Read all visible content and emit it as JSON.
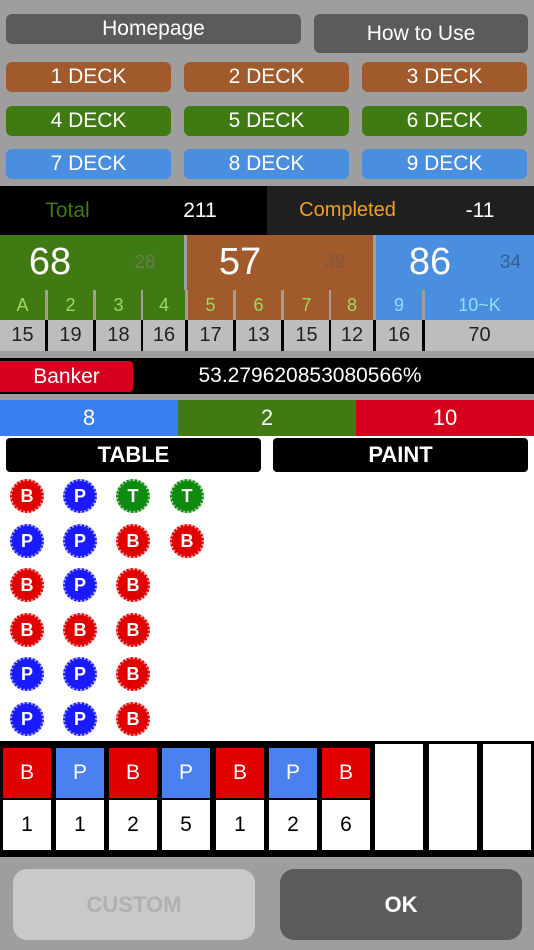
{
  "nav": {
    "homepage": "Homepage",
    "how_to_use": "How to Use"
  },
  "decks": [
    "1 DECK",
    "2 DECK",
    "3 DECK",
    "4 DECK",
    "5 DECK",
    "6 DECK",
    "7 DECK",
    "8 DECK",
    "9 DECK"
  ],
  "deck_colors": {
    "brown": "#a05a2c",
    "green": "#3f7a12",
    "blue": "#4a8ee0"
  },
  "stats": {
    "total_label": "Total",
    "total_value": "211",
    "completed_label": "Completed",
    "completed_value": "-11"
  },
  "boxes": [
    {
      "big": "68",
      "small": "28",
      "color": "#3f7a12",
      "small_color": "#6b7d52"
    },
    {
      "big": "57",
      "small": "39",
      "color": "#a05a2c",
      "small_color": "#7e5a3e"
    },
    {
      "big": "86",
      "small": "34",
      "color": "#4a8ee0",
      "small_color": "#3a5e8e"
    }
  ],
  "ranks": [
    "A",
    "2",
    "3",
    "4",
    "5",
    "6",
    "7",
    "8",
    "9",
    "10~K"
  ],
  "counts": [
    "15",
    "19",
    "18",
    "16",
    "17",
    "13",
    "15",
    "12",
    "16",
    "70"
  ],
  "percent": {
    "label": "Banker",
    "value": "53.279620853080566%"
  },
  "tri": {
    "player": "8",
    "tie": "2",
    "banker": "10"
  },
  "tabs": {
    "table": "TABLE",
    "paint": "PAINT"
  },
  "grid": [
    [
      "B",
      "P",
      "T",
      "T"
    ],
    [
      "P",
      "P",
      "B",
      "B"
    ],
    [
      "B",
      "P",
      "B"
    ],
    [
      "B",
      "B",
      "B"
    ],
    [
      "P",
      "P",
      "B"
    ],
    [
      "P",
      "P",
      "B"
    ]
  ],
  "strip": [
    {
      "label": "B",
      "num": "1"
    },
    {
      "label": "P",
      "num": "1"
    },
    {
      "label": "B",
      "num": "2"
    },
    {
      "label": "P",
      "num": "5"
    },
    {
      "label": "B",
      "num": "1"
    },
    {
      "label": "P",
      "num": "2"
    },
    {
      "label": "B",
      "num": "6"
    }
  ],
  "footer": {
    "custom": "CUSTOM",
    "ok": "OK"
  },
  "colors": {
    "banker": "#e00000",
    "player": "#1a1aff",
    "tie": "#0e8a0e"
  }
}
